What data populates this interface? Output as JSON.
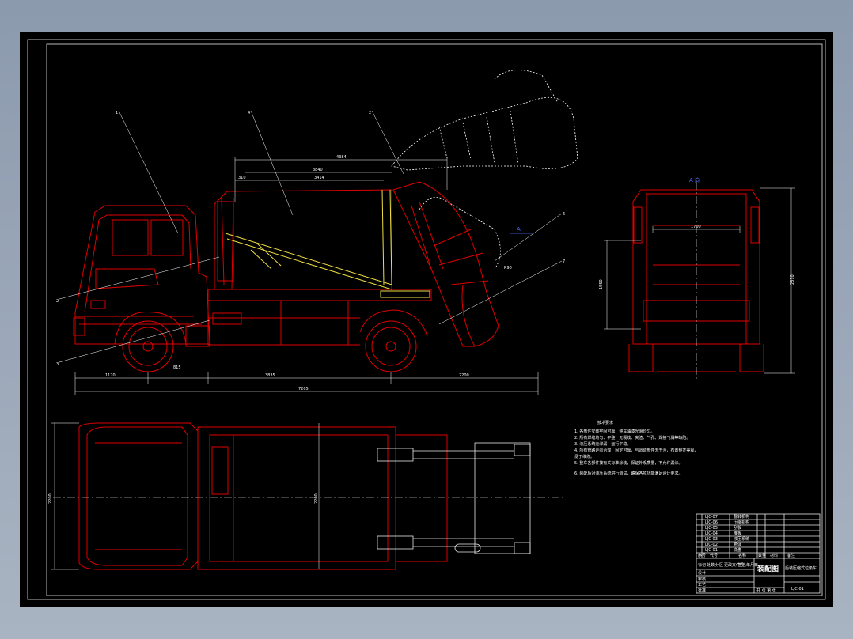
{
  "side_view": {
    "dims": {
      "overall_box": "4384",
      "box_inner": "3840",
      "box_inner2": "3414",
      "front_offset": "310",
      "front_overhang": "1170",
      "cab_wheel": "815",
      "wheelbase": "3835",
      "rear_overhang": "2200",
      "total_length": "7205",
      "tailgate_radius": "R90"
    },
    "leaders": [
      "1",
      "4",
      "2",
      "2",
      "3",
      "6",
      "7"
    ]
  },
  "rear_view": {
    "section_mark": "A 向",
    "dims": {
      "width": "1700",
      "height_left": "1550",
      "height_right": "2310"
    }
  },
  "side_marker": "A",
  "plan_view": {
    "dims": {
      "cab_width": "2200",
      "body_width": "2200"
    }
  },
  "tech_req": {
    "title": "技术要求",
    "items": [
      "1. 各部件安装牢固可靠，整车油漆光滑均匀。",
      "2. 所有焊缝均匀、平整，无裂纹、夹渣、气孔、焊接飞溅等缺陷。",
      "3. 液压系统无渗漏，运行平稳。",
      "4. 所有管路走向合理，固定可靠，与运动部件无干涉，布置整齐美观，",
      "   便于维修。",
      "5. 整车各部件按有关标准涂装，保证外观质量，不允许漏涂。",
      "6. 装配后对液压系统进行调试，确保各项功能满足设计要求。"
    ]
  },
  "title_block": {
    "drawing_title": "装配图",
    "designer_title": "后装压缩式垃圾车",
    "scale_label": "共 张 第 张",
    "drawing_no": "LJC-01",
    "left_rows": [
      "LJC-07",
      "LJC-06",
      "LJC-05",
      "LJC-04",
      "LJC-03",
      "LJC-02",
      "LJC-01"
    ],
    "name_rows": [
      "翻转机构",
      "压缩机构",
      "刮板",
      "推板",
      "液压系统",
      "厢体",
      "底盘"
    ],
    "header_cols": [
      "序号",
      "代号",
      "名称",
      "数量",
      "材料",
      "备注"
    ],
    "sign_rows": [
      "标记",
      "处数",
      "分区",
      "更改文件号",
      "签名",
      "年月日"
    ],
    "role_rows": [
      "设计",
      "审核",
      "工艺",
      "批准"
    ]
  },
  "colors": {
    "outline": "#e00000",
    "dimension": "#ffffff",
    "hydraulic": "#f0e040",
    "marker": "#4a6cff",
    "frame": "#ffffff",
    "background": "#000000"
  }
}
